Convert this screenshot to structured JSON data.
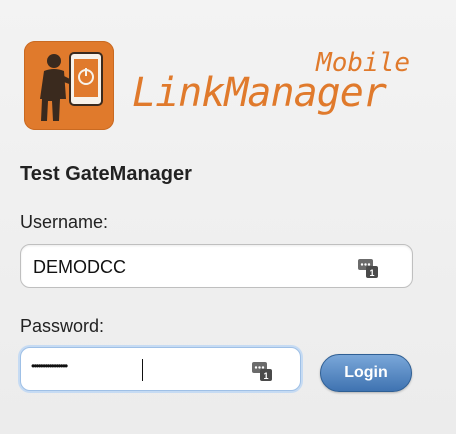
{
  "brand": {
    "logo_sub": "Mobile",
    "logo_main": "LinkManager",
    "color": "#e07a2c"
  },
  "form": {
    "title": "Test GateManager",
    "username_label": "Username:",
    "username_value": "DEMODCC",
    "password_label": "Password:",
    "password_mask": "••••••••••••••••",
    "login_label": "Login"
  },
  "icons": {
    "username_field": "password-manager-key-icon",
    "password_field": "password-manager-key-icon"
  },
  "colors": {
    "button": "#4b7fbe",
    "focus": "#9fc0e6"
  }
}
